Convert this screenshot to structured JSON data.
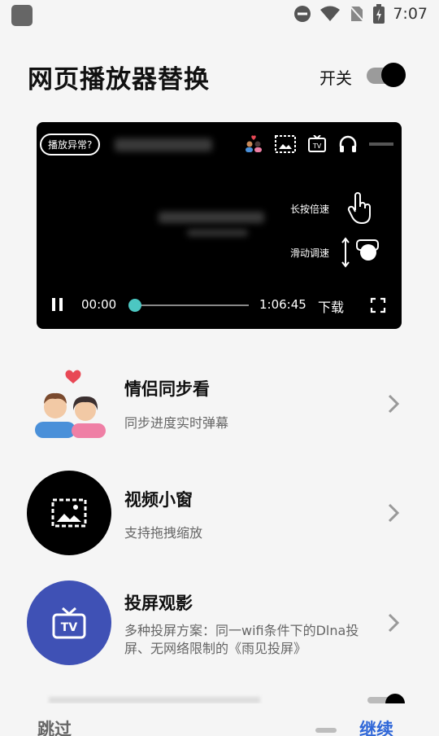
{
  "status_bar": {
    "time": "7:07"
  },
  "header": {
    "title": "网页播放器替换",
    "switch_label": "开关",
    "switch_on": true
  },
  "player": {
    "issue_pill": "播放异常?",
    "hint_long_press": "长按倍速",
    "hint_slide": "滑动调速",
    "time_current": "00:00",
    "time_total": "1:06:45",
    "download_label": "下载",
    "progress": 0.0
  },
  "features": [
    {
      "title": "情侣同步看",
      "subtitle": "同步进度实时弹幕",
      "icon": "couple-icon"
    },
    {
      "title": "视频小窗",
      "subtitle": "支持拖拽缩放",
      "icon": "picture-in-picture-icon"
    },
    {
      "title": "投屏观影",
      "subtitle": "多种投屏方案：同一wifi条件下的Dlna投屏、无网络限制的《雨见投屏》",
      "icon": "tv-icon"
    }
  ],
  "footer": {
    "skip_label": "跳过",
    "continue_label": "继续"
  },
  "colors": {
    "accent": "#2f67d8",
    "progress_thumb": "#4cc7c2",
    "tv_circle": "#3f51b5",
    "pip_circle": "#000000"
  }
}
